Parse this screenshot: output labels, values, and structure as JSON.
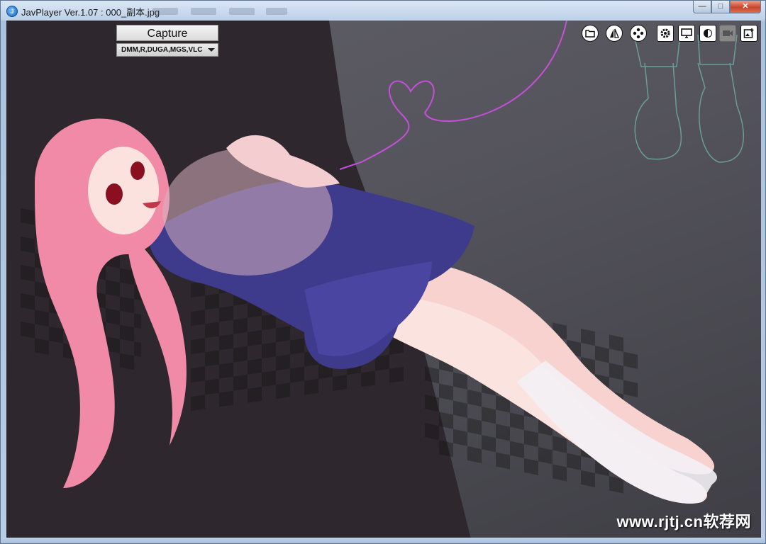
{
  "window": {
    "title": "JavPlayer Ver.1.07 : 000_副本.jpg",
    "app_icon_glyph": "J",
    "minimize_glyph": "—",
    "maximize_glyph": "□",
    "close_glyph": "✕"
  },
  "controls": {
    "capture_label": "Capture",
    "source_value": "DMM,R,DUGA,MGS,VLC"
  },
  "toolbar": {
    "icons": [
      "folder-icon",
      "mirror-icon",
      "gamepad-icon",
      "gear-icon",
      "monitor-icon",
      "brightness-icon",
      "camera-icon",
      "add-image-icon"
    ]
  },
  "viewer": {
    "watermark": "www.rjtj.cn软荐网"
  },
  "colors": {
    "accent_pink": "#c64fd9",
    "hair_pink": "#f08aa6",
    "dress_blue": "#3e3a8c"
  }
}
